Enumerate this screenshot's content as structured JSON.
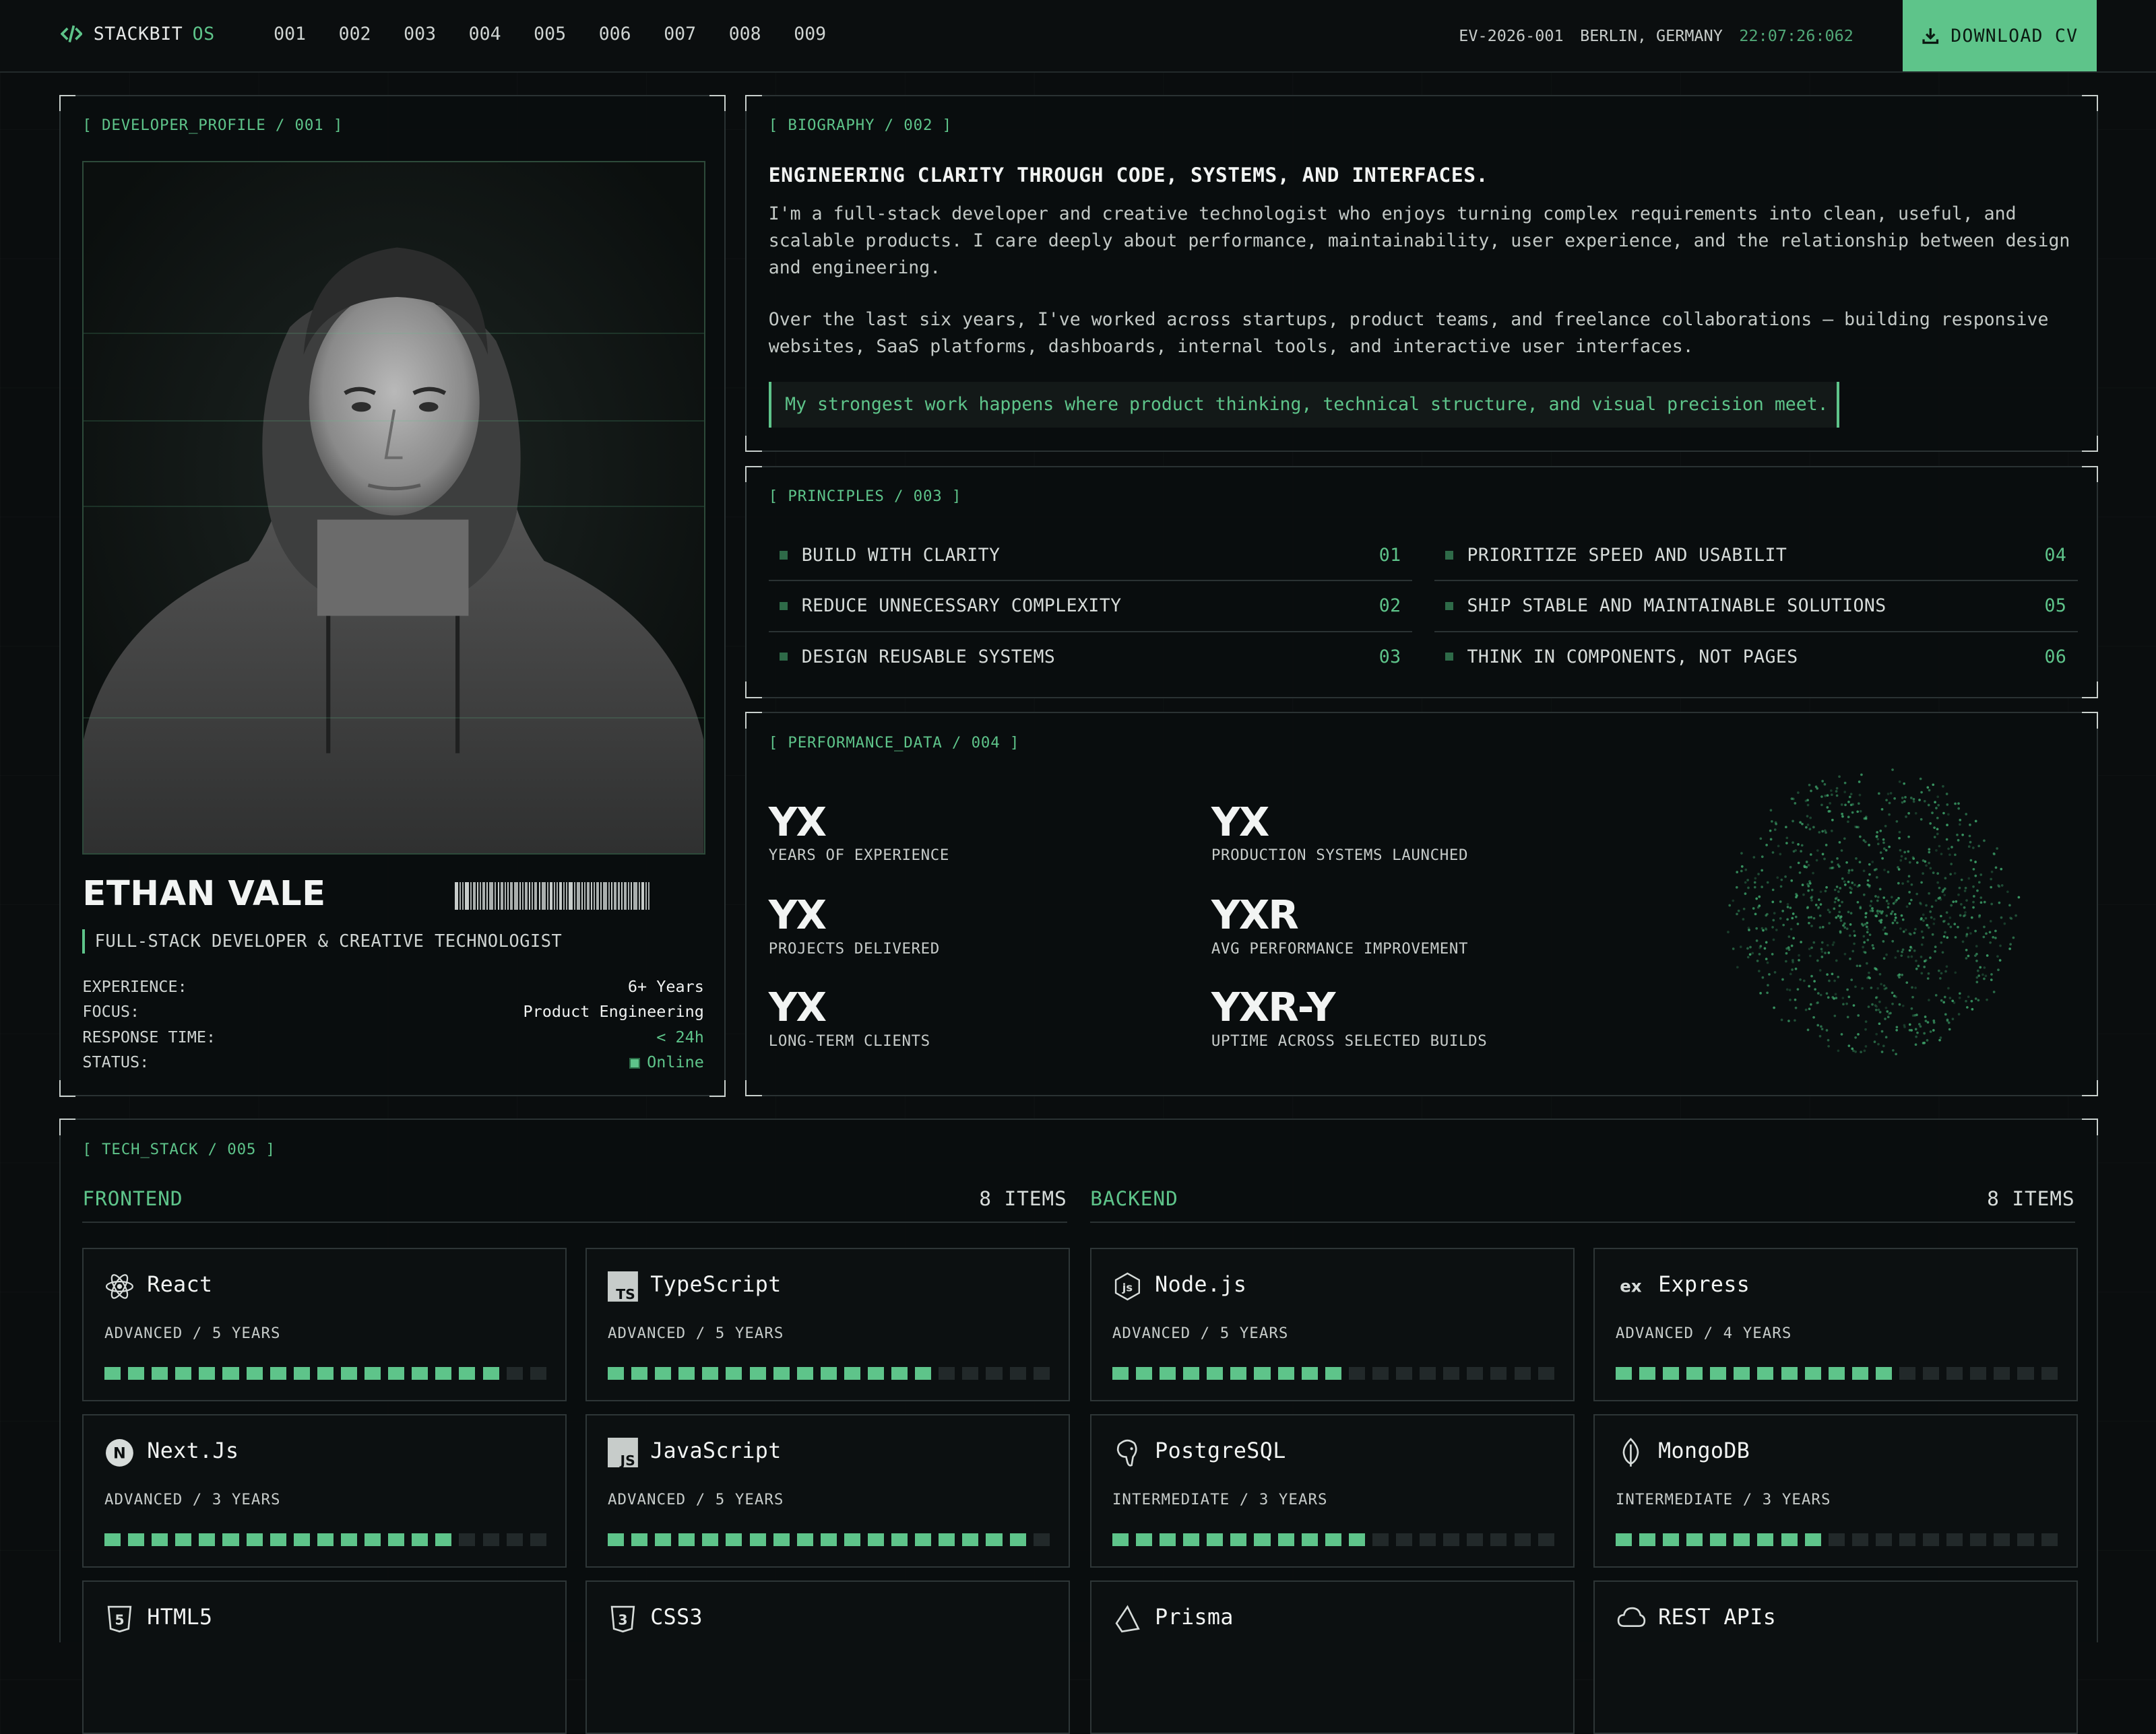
{
  "nav": {
    "brand": "STACKBIT",
    "brand_suffix": "OS",
    "items": [
      "001",
      "002",
      "003",
      "004",
      "005",
      "006",
      "007",
      "008",
      "009"
    ],
    "doc_id": "EV-2026-001",
    "location": "BERLIN, GERMANY",
    "clock": "22:07:26:062",
    "download_label": "DOWNLOAD CV"
  },
  "profile": {
    "tag": "[ DEVELOPER_PROFILE / 001 ]",
    "name": "ETHAN VALE",
    "role": "FULL-STACK DEVELOPER & CREATIVE TECHNOLOGIST",
    "facts": [
      {
        "k": "EXPERIENCE:",
        "v": "6+ Years"
      },
      {
        "k": "FOCUS:",
        "v": "Product Engineering"
      },
      {
        "k": "RESPONSE TIME:",
        "v": "< 24h"
      },
      {
        "k": "STATUS:",
        "v": "Online"
      }
    ]
  },
  "bio": {
    "tag": "[ BIOGRAPHY / 002 ]",
    "heading": "ENGINEERING CLARITY THROUGH CODE, SYSTEMS, AND INTERFACES.",
    "p1": "I'm a full-stack developer and creative technologist who enjoys turning complex requirements into clean, useful, and scalable products. I care deeply about performance, maintainability, user experience, and the relationship between design and engineering.",
    "p2": "Over the last six years, I've worked across startups, product teams, and freelance collaborations — building responsive websites, SaaS platforms, dashboards, internal tools, and interactive user interfaces.",
    "quote": "My strongest work happens where product thinking, technical structure, and visual precision meet."
  },
  "principles": {
    "tag": "[ PRINCIPLES / 003 ]",
    "items": [
      {
        "label": "BUILD WITH CLARITY",
        "n": "01"
      },
      {
        "label": "REDUCE UNNECESSARY COMPLEXITY",
        "n": "02"
      },
      {
        "label": "DESIGN REUSABLE SYSTEMS",
        "n": "03"
      },
      {
        "label": "PRIORITIZE SPEED AND USABILIT",
        "n": "04"
      },
      {
        "label": "SHIP STABLE AND MAINTAINABLE SOLUTIONS",
        "n": "05"
      },
      {
        "label": "THINK IN COMPONENTS, NOT PAGES",
        "n": "06"
      }
    ]
  },
  "performance": {
    "tag": "[ PERFORMANCE_DATA / 004 ]",
    "stats": [
      {
        "value": "YX",
        "label": "YEARS OF EXPERIENCE"
      },
      {
        "value": "YX",
        "label": "PRODUCTION SYSTEMS LAUNCHED"
      },
      {
        "value": "YX",
        "label": "PROJECTS DELIVERED"
      },
      {
        "value": "YXR",
        "label": "AVG PERFORMANCE IMPROVEMENT"
      },
      {
        "value": "YX",
        "label": "LONG-TERM CLIENTS"
      },
      {
        "value": "YXR-Y",
        "label": "UPTIME ACROSS SELECTED BUILDS"
      }
    ]
  },
  "stack": {
    "tag": "[ TECH_STACK / 005 ]",
    "frontend": {
      "title": "FRONTEND",
      "count": "8 ITEMS"
    },
    "backend": {
      "title": "BACKEND",
      "count": "8 ITEMS"
    },
    "cards": [
      {
        "icon": "react-icon",
        "name": "React",
        "level": "ADVANCED / 5 YEARS",
        "filled": 17
      },
      {
        "icon": "typescript-icon",
        "name": "TypeScript",
        "level": "ADVANCED / 5 YEARS",
        "filled": 14
      },
      {
        "icon": "nodejs-icon",
        "name": "Node.js",
        "level": "ADVANCED / 5 YEARS",
        "filled": 10
      },
      {
        "icon": "express-icon",
        "name": "Express",
        "level": "ADVANCED / 4 YEARS",
        "filled": 12
      },
      {
        "icon": "nextjs-icon",
        "name": "Next.Js",
        "level": "ADVANCED / 3 YEARS",
        "filled": 15
      },
      {
        "icon": "javascript-icon",
        "name": "JavaScript",
        "level": "ADVANCED / 5 YEARS",
        "filled": 18
      },
      {
        "icon": "postgresql-icon",
        "name": "PostgreSQL",
        "level": "INTERMEDIATE / 3 YEARS",
        "filled": 11
      },
      {
        "icon": "mongodb-icon",
        "name": "MongoDB",
        "level": "INTERMEDIATE / 3 YEARS",
        "filled": 9
      },
      {
        "icon": "html5-icon",
        "name": "HTML5",
        "level": "",
        "filled": 0
      },
      {
        "icon": "css3-icon",
        "name": "CSS3",
        "level": "",
        "filled": 0
      },
      {
        "icon": "prisma-icon",
        "name": "Prisma",
        "level": "",
        "filled": 0
      },
      {
        "icon": "rest-api-icon",
        "name": "REST APIs",
        "level": "",
        "filled": 0
      }
    ],
    "segments_total": 19
  },
  "colors": {
    "accent": "#5ec48a",
    "background": "#0a0d0e"
  }
}
